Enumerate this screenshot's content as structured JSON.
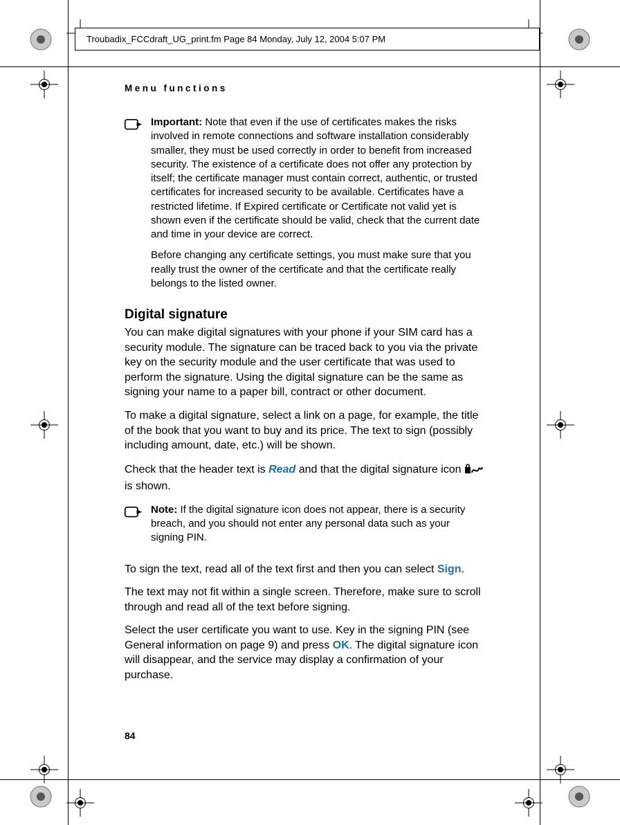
{
  "header": {
    "slug": "Troubadix_FCCdraft_UG_print.fm  Page 84  Monday, July 12, 2004  5:07 PM"
  },
  "page": {
    "running_head": "Menu functions",
    "number": "84"
  },
  "callout_important": {
    "label": "Important:",
    "p1": " Note that even if the use of certificates makes the risks involved in remote connections and software installation considerably smaller, they must be used correctly in order to benefit from increased security. The existence of a certificate does not offer any protection by itself; the certificate manager must contain correct, authentic, or trusted certificates for increased security to be available. Certificates have a restricted lifetime. If Expired certificate or Certificate not valid yet is shown even if the certificate should be valid, check that the current date and time in your device are correct.",
    "p2": "Before changing any certificate settings, you must make sure that you really trust the owner of the certificate and that the certificate really belongs to the listed owner."
  },
  "section_heading": "Digital signature",
  "body": {
    "p1": "You can make digital signatures with your phone if your SIM card has a security module. The signature can be traced back to you via the private key on the security module and the user certificate that was used to perform the signature. Using the digital signature can be the same as signing your name to a paper bill, contract or other document.",
    "p2": "To make a digital signature, select a link on a page, for example, the title of the book that you want to buy and its price. The text to sign (possibly including amount, date, etc.) will be shown.",
    "p3_pre": "Check that the header text is ",
    "p3_link": "Read",
    "p3_mid": " and that the digital signature icon ",
    "p3_post": " is shown.",
    "p4_pre": "To sign the text, read all of the text first and then you can select ",
    "p4_link": "Sign",
    "p4_post": ".",
    "p5": "The text may not fit within a single screen. Therefore, make sure to scroll through and read all of the text before signing.",
    "p6_pre": "Select the user certificate you want to use. Key in the signing PIN (see General information on page 9) and press ",
    "p6_link": "OK",
    "p6_post": ". The digital signature icon will disappear, and the service may display a confirmation of your purchase."
  },
  "callout_note": {
    "label": "Note:",
    "p1": " If the digital signature icon does not appear, there is a security breach, and you should not enter any personal data such as your signing PIN."
  },
  "link_color": "#1a6fb0"
}
